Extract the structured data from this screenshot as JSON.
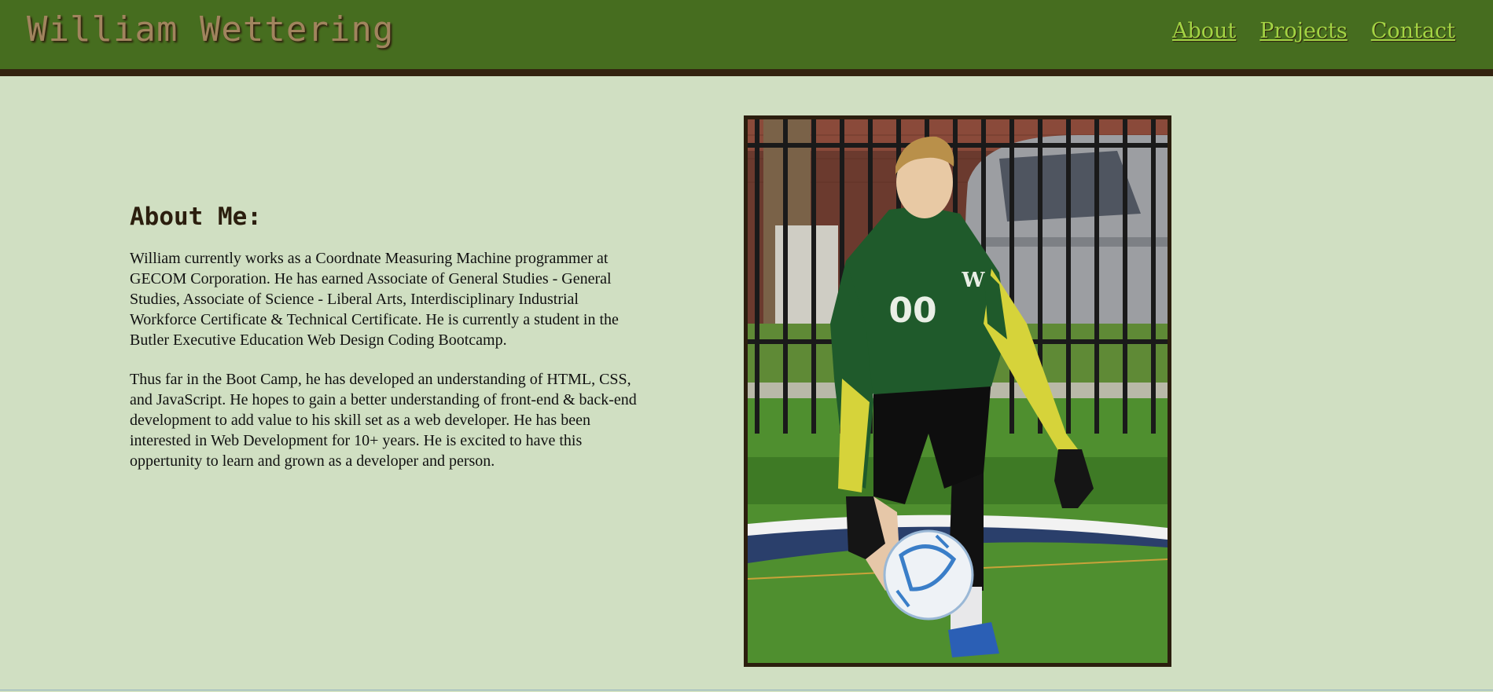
{
  "header": {
    "title": "William Wettering",
    "nav": [
      {
        "label": "About"
      },
      {
        "label": "Projects"
      },
      {
        "label": "Contact"
      }
    ]
  },
  "about": {
    "heading": "About Me:",
    "paragraphs": [
      "William currently works as a Coordnate Measuring Machine programmer at GECOM Corporation. He has earned Associate of General Studies - General Studies, Associate of Science - Liberal Arts, Interdisciplinary Industrial Workforce Certificate & Technical Certificate. He is currently a student in the Butler Executive Education Web Design Coding Bootcamp.",
      "Thus far in the Boot Camp, he has developed an understanding of HTML, CSS, and JavaScript. He hopes to gain a better understanding of front-end & back-end development to add value to his skill set as a web developer. He has been interested in Web Development for 10+ years. He is excited to have this oppertunity to learn and grown as a developer and person."
    ]
  },
  "photo": {
    "jersey_number": "00",
    "jersey_letter": "W"
  },
  "colors": {
    "header_bg": "#466d1f",
    "header_border": "#33230f",
    "page_bg": "#d0dfc2",
    "title": "#a1845e",
    "nav_link": "#a3d444"
  }
}
